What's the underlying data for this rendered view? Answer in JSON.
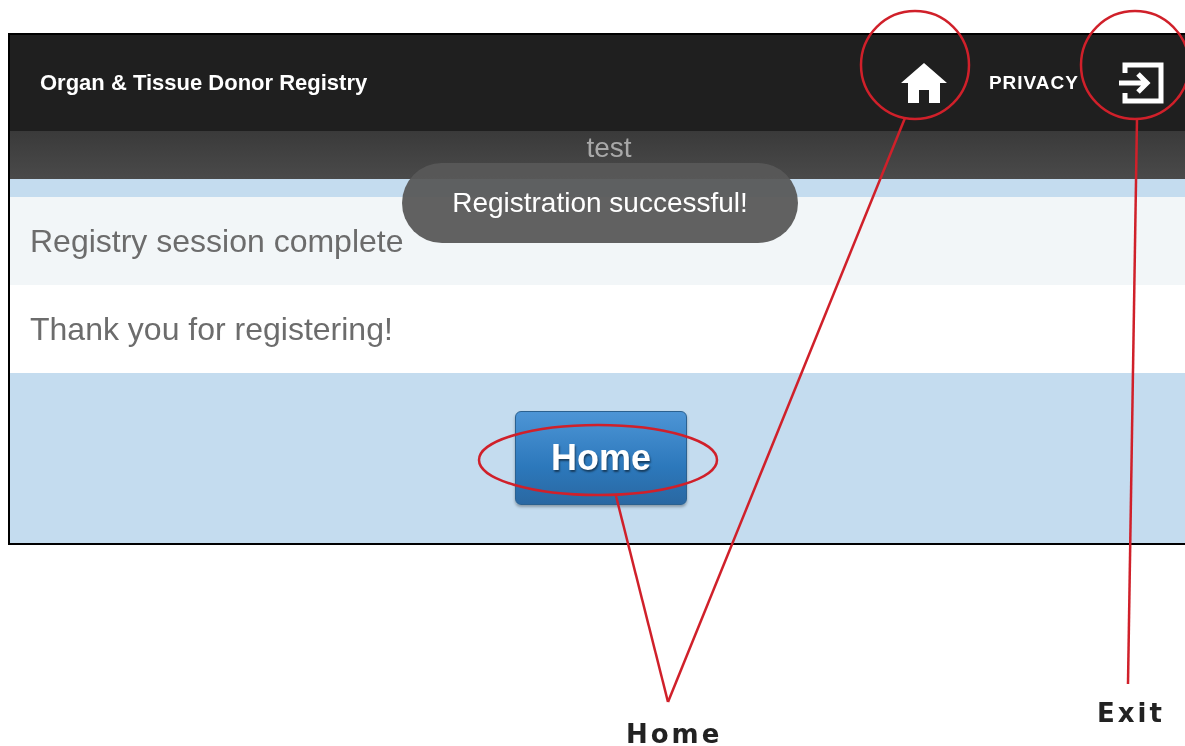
{
  "header": {
    "title": "Organ & Tissue Donor Registry",
    "privacy": "PRIVACY"
  },
  "subheader": {
    "title": "test"
  },
  "toast": {
    "message": "Registration successful!"
  },
  "rows": [
    "Registry session complete",
    "Thank you for registering!"
  ],
  "button": {
    "label": "Home"
  },
  "annotations": [
    {
      "label": "Home"
    },
    {
      "label": "Exit"
    }
  ]
}
